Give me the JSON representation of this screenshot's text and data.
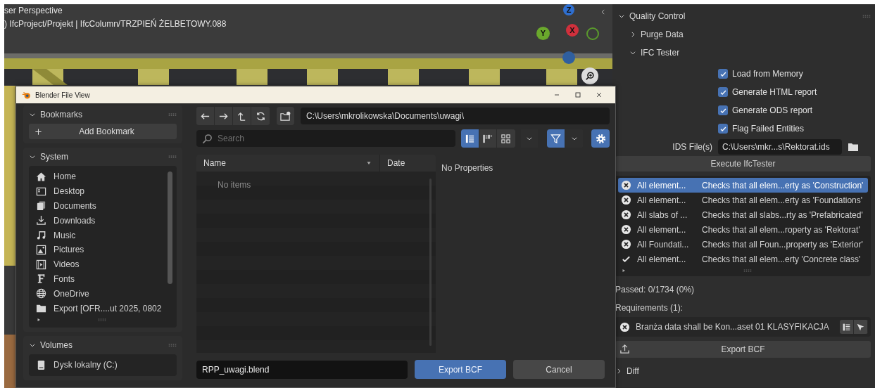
{
  "viewport": {
    "view_name": "ser Perspective",
    "breadcrumb": ") IfcProject/Projekt | IfcColumn/TRZPIEŃ ŻELBETOWY.088",
    "gizmo": [
      {
        "label": "Z",
        "color": "#2f6fd0"
      },
      {
        "label": "Y",
        "color": "#6aa82c"
      },
      {
        "label": "X",
        "color": "#d0303c"
      }
    ]
  },
  "file_dialog": {
    "title": "Blender File View",
    "bookmarks": {
      "title": "Bookmarks",
      "expanded": true,
      "add_button": "Add Bookmark"
    },
    "system": {
      "title": "System",
      "expanded": true,
      "items": [
        {
          "label": "Home",
          "kind": "home"
        },
        {
          "label": "Desktop",
          "kind": "desktop"
        },
        {
          "label": "Documents",
          "kind": "documents"
        },
        {
          "label": "Downloads",
          "kind": "downloads"
        },
        {
          "label": "Music",
          "kind": "music"
        },
        {
          "label": "Pictures",
          "kind": "pictures"
        },
        {
          "label": "Videos",
          "kind": "videos"
        },
        {
          "label": "Fonts",
          "kind": "fonts"
        },
        {
          "label": "OneDrive",
          "kind": "globe"
        },
        {
          "label": "Export [OFR....ut 2025, 0802",
          "kind": "folder"
        }
      ]
    },
    "volumes": {
      "title": "Volumes",
      "expanded": true,
      "items": [
        {
          "label": "Dysk lokalny (C:)",
          "kind": "disk"
        }
      ]
    },
    "path": "C:\\Users\\mkrolikowska\\Documents\\uwagi\\",
    "search": {
      "placeholder": "Search"
    },
    "view_modes": [
      {
        "kind": "vertical",
        "selected": true
      },
      {
        "kind": "horizontal",
        "selected": false
      },
      {
        "kind": "thumbnails",
        "selected": false
      }
    ],
    "filter": {
      "on": true
    },
    "columns": [
      {
        "label": "Name",
        "sorted": true
      },
      {
        "label": "Date",
        "sorted": false
      }
    ],
    "empty_text": "No items",
    "properties_text": "No Properties",
    "filename": "RPP_uwagi.blend",
    "buttons": [
      {
        "label": "Export BCF",
        "kind": "primary"
      },
      {
        "label": "Cancel",
        "kind": "secondary"
      }
    ]
  },
  "properties_panel": {
    "title": "Quality Control",
    "expanded": true,
    "subpanels": [
      {
        "title": "Purge Data",
        "expanded": false
      },
      {
        "title": "IFC Tester",
        "expanded": true
      }
    ],
    "options": [
      {
        "label": "Load from Memory",
        "checked": true
      },
      {
        "label": "Generate HTML report",
        "checked": true
      },
      {
        "label": "Generate ODS report",
        "checked": true
      },
      {
        "label": "Flag Failed Entities",
        "checked": true
      }
    ],
    "ids_file": {
      "label": "IDS File(s)",
      "value": "C:\\Users\\mkr...s\\Rektorat.ids"
    },
    "execute_button": "Execute IfcTester",
    "specs": [
      {
        "name": "All element...",
        "description": "Checks that all elem...erty as 'Construction'",
        "passed": false,
        "selected": true
      },
      {
        "name": "All element...",
        "description": "Checks that all elem...erty as 'Foundations'",
        "passed": false,
        "selected": false
      },
      {
        "name": "All slabs of ...",
        "description": "Checks that all slabs...rty as 'Prefabricated'",
        "passed": false,
        "selected": false
      },
      {
        "name": "All element...",
        "description": "Checks that all elem...roperty as 'Rektorat'",
        "passed": false,
        "selected": false
      },
      {
        "name": "All Foundati...",
        "description": "Checks that all Foun...property as 'Exterior'",
        "passed": false,
        "selected": false
      },
      {
        "name": "All element...",
        "description": "Checks that all elem...erty 'Concrete class'",
        "passed": true,
        "selected": false
      }
    ],
    "passed": "Passed: 0/1734 (0%)",
    "requirements_label": "Requirements (1):",
    "requirements": [
      {
        "text": "Branża data shall be Kon...aset 01 KLASYFIKACJA",
        "passed": false
      }
    ],
    "export_button": "Export BCF",
    "diff": {
      "title": "Diff",
      "expanded": false
    }
  }
}
